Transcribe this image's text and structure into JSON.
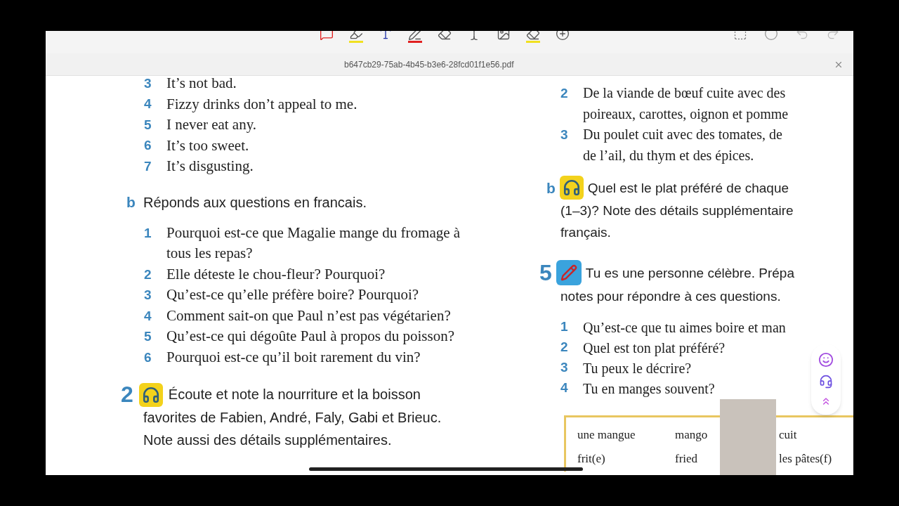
{
  "file_tab": {
    "filename": "b647cb29-75ab-4b45-b3e6-28fcd01f1e56.pdf"
  },
  "left_column": {
    "answer_items": [
      {
        "number": "3",
        "text": "It’s not bad."
      },
      {
        "number": "4",
        "text": "Fizzy drinks don’t appeal to me."
      },
      {
        "number": "5",
        "text": "I never eat any."
      },
      {
        "number": "6",
        "text": "It’s too sweet."
      },
      {
        "number": "7",
        "text": "It’s disgusting."
      }
    ],
    "task_b": {
      "letter": "b",
      "instruction": "Réponds aux questions en francais.",
      "questions": [
        {
          "number": "1",
          "text": "Pourquoi est-ce que Magalie mange du fromage à tous les repas?"
        },
        {
          "number": "2",
          "text": "Elle déteste le chou-fleur? Pourquoi?"
        },
        {
          "number": "3",
          "text": "Qu’est-ce qu’elle préfère boire? Pourquoi?"
        },
        {
          "number": "4",
          "text": "Comment sait-on que Paul n’est pas végétarien?"
        },
        {
          "number": "5",
          "text": "Qu’est-ce qui dégoûte Paul à propos du poisson?"
        },
        {
          "number": "6",
          "text": "Pourquoi est-ce qu’il boit rarement du vin?"
        }
      ]
    },
    "exercise_2": {
      "number": "2",
      "lines": [
        "Écoute et note la nourriture et la boisson",
        "favorites de Fabien, André, Faly, Gabi et Brieuc.",
        "Note aussi des détails supplémentaires."
      ]
    }
  },
  "right_column": {
    "dishes": [
      {
        "number": "2",
        "lines": [
          "De la viande de bœuf cuite avec des",
          "poireaux, carottes, oignon et pomme"
        ]
      },
      {
        "number": "3",
        "lines": [
          "Du poulet cuit avec des tomates, de",
          "de l’ail, du thym et des épices."
        ]
      }
    ],
    "task_b": {
      "letter": "b",
      "lines": [
        "Quel est le plat préféré de chaque",
        "(1–3)? Note des détails supplémentaire",
        "français."
      ]
    },
    "exercise_5": {
      "number": "5",
      "lines": [
        "Tu es une personne célèbre. Prépa",
        "notes pour répondre à ces questions."
      ],
      "questions": [
        {
          "number": "1",
          "text": "Qu’est-ce que tu aimes boire et man"
        },
        {
          "number": "2",
          "text": "Quel est ton plat préféré?"
        },
        {
          "number": "3",
          "text": "Tu peux le décrire?"
        },
        {
          "number": "4",
          "text": "Tu en manges souvent?"
        }
      ]
    },
    "vocabulary": [
      [
        "une mangue",
        "mango",
        "cuit"
      ],
      [
        "frit(e)",
        "fried",
        "les pâtes(f)"
      ]
    ]
  }
}
